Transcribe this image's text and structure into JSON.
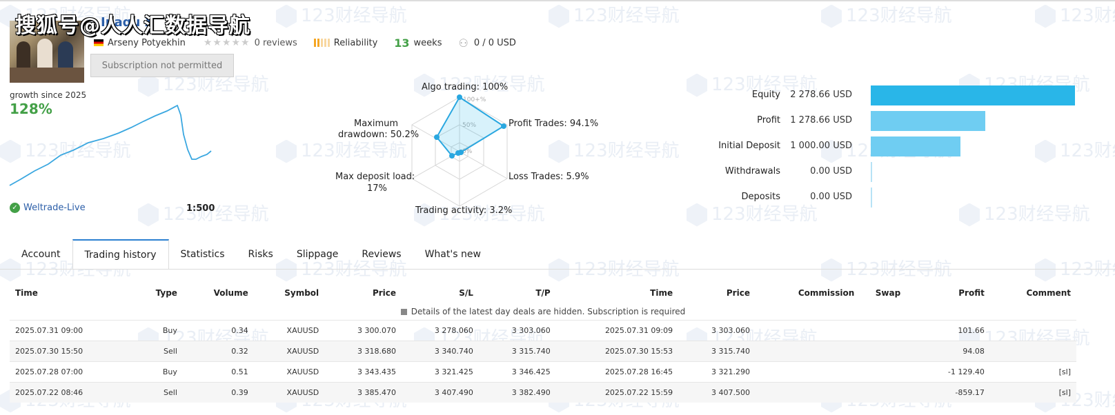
{
  "overlay": {
    "title": "搜狐号@人人汇数据导航"
  },
  "watermark": {
    "text": "123财经导航"
  },
  "signal": {
    "name": "Inaqu X",
    "author": "Arseny Potyekhin",
    "reviews": "0 reviews",
    "stars_rating": 0,
    "reliability_label": "Reliability",
    "weeks_num": "13",
    "weeks_label": "weeks",
    "subscribers": "0 / 0 USD",
    "subscribe_button": "Subscription not permitted"
  },
  "growth": {
    "label": "growth since 2025",
    "value": "128%",
    "broker": "Weltrade-Live",
    "leverage": "1:500"
  },
  "radar": {
    "labels": {
      "algo": "Algo trading: 100%",
      "profit": "Profit Trades: 94.1%",
      "loss": "Loss Trades: 5.9%",
      "activity": "Trading activity: 3.2%",
      "load_1": "Max deposit load:",
      "load_2": "17%",
      "dd_1": "Maximum",
      "dd_2": "drawdown: 50.2%"
    },
    "scale": {
      "outer": "100+%",
      "mid": "50%",
      "inner": "0%"
    }
  },
  "chart_data": {
    "type": "bar",
    "orientation": "horizontal",
    "categories": [
      "Equity",
      "Profit",
      "Initial Deposit",
      "Withdrawals",
      "Deposits"
    ],
    "values": [
      2278.66,
      1278.66,
      1000.0,
      0.0,
      0.0
    ],
    "value_labels": [
      "2 278.66 USD",
      "1 278.66 USD",
      "1 000.00 USD",
      "0.00 USD",
      "0.00 USD"
    ],
    "colors": [
      "#29b6e8",
      "#6fcdf2",
      "#6fcdf2",
      "#b7e3f6",
      "#b7e3f6"
    ]
  },
  "tabs": [
    "Account",
    "Trading history",
    "Statistics",
    "Risks",
    "Slippage",
    "Reviews",
    "What's new"
  ],
  "table": {
    "headers": [
      "Time",
      "Type",
      "Volume",
      "Symbol",
      "Price",
      "S/L",
      "T/P",
      "Time",
      "Price",
      "Commission",
      "Swap",
      "Profit",
      "Comment"
    ],
    "notice": "Details of the latest day deals are hidden. Subscription is required",
    "rows": [
      [
        "2025.07.31 09:00",
        "Buy",
        "0.34",
        "XAUUSD",
        "3 300.070",
        "3 278.060",
        "3 303.060",
        "2025.07.31 09:09",
        "3 303.060",
        "",
        "",
        "101.66",
        ""
      ],
      [
        "2025.07.30 15:50",
        "Sell",
        "0.32",
        "XAUUSD",
        "3 318.680",
        "3 340.740",
        "3 315.740",
        "2025.07.30 15:53",
        "3 315.740",
        "",
        "",
        "94.08",
        ""
      ],
      [
        "2025.07.28 07:00",
        "Buy",
        "0.51",
        "XAUUSD",
        "3 343.435",
        "3 321.425",
        "3 346.425",
        "2025.07.28 16:45",
        "3 321.290",
        "",
        "",
        "-1 129.40",
        "[sl]"
      ],
      [
        "2025.07.22 08:46",
        "Sell",
        "0.39",
        "XAUUSD",
        "3 385.470",
        "3 407.490",
        "3 382.490",
        "2025.07.22 15:59",
        "3 407.500",
        "",
        "",
        "-859.17",
        "[sl]"
      ]
    ]
  }
}
